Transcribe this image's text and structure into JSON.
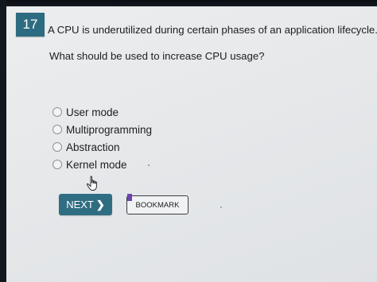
{
  "question": {
    "number": "17",
    "line1": "A CPU is underutilized during certain phases of an application lifecycle.",
    "line2": "What should be used to increase CPU usage?"
  },
  "options": [
    {
      "label": "User mode",
      "selected": false
    },
    {
      "label": "Multiprogramming",
      "selected": false
    },
    {
      "label": "Abstraction",
      "selected": false
    },
    {
      "label": "Kernel mode",
      "selected": false
    }
  ],
  "buttons": {
    "next_label": "NEXT",
    "next_icon": "chevron-right-icon",
    "bookmark_label": "BOOKMARK"
  },
  "colors": {
    "badge": "#2d6b80",
    "next_button": "#2f6e82",
    "bookmark_flag": "#6b44b0"
  }
}
